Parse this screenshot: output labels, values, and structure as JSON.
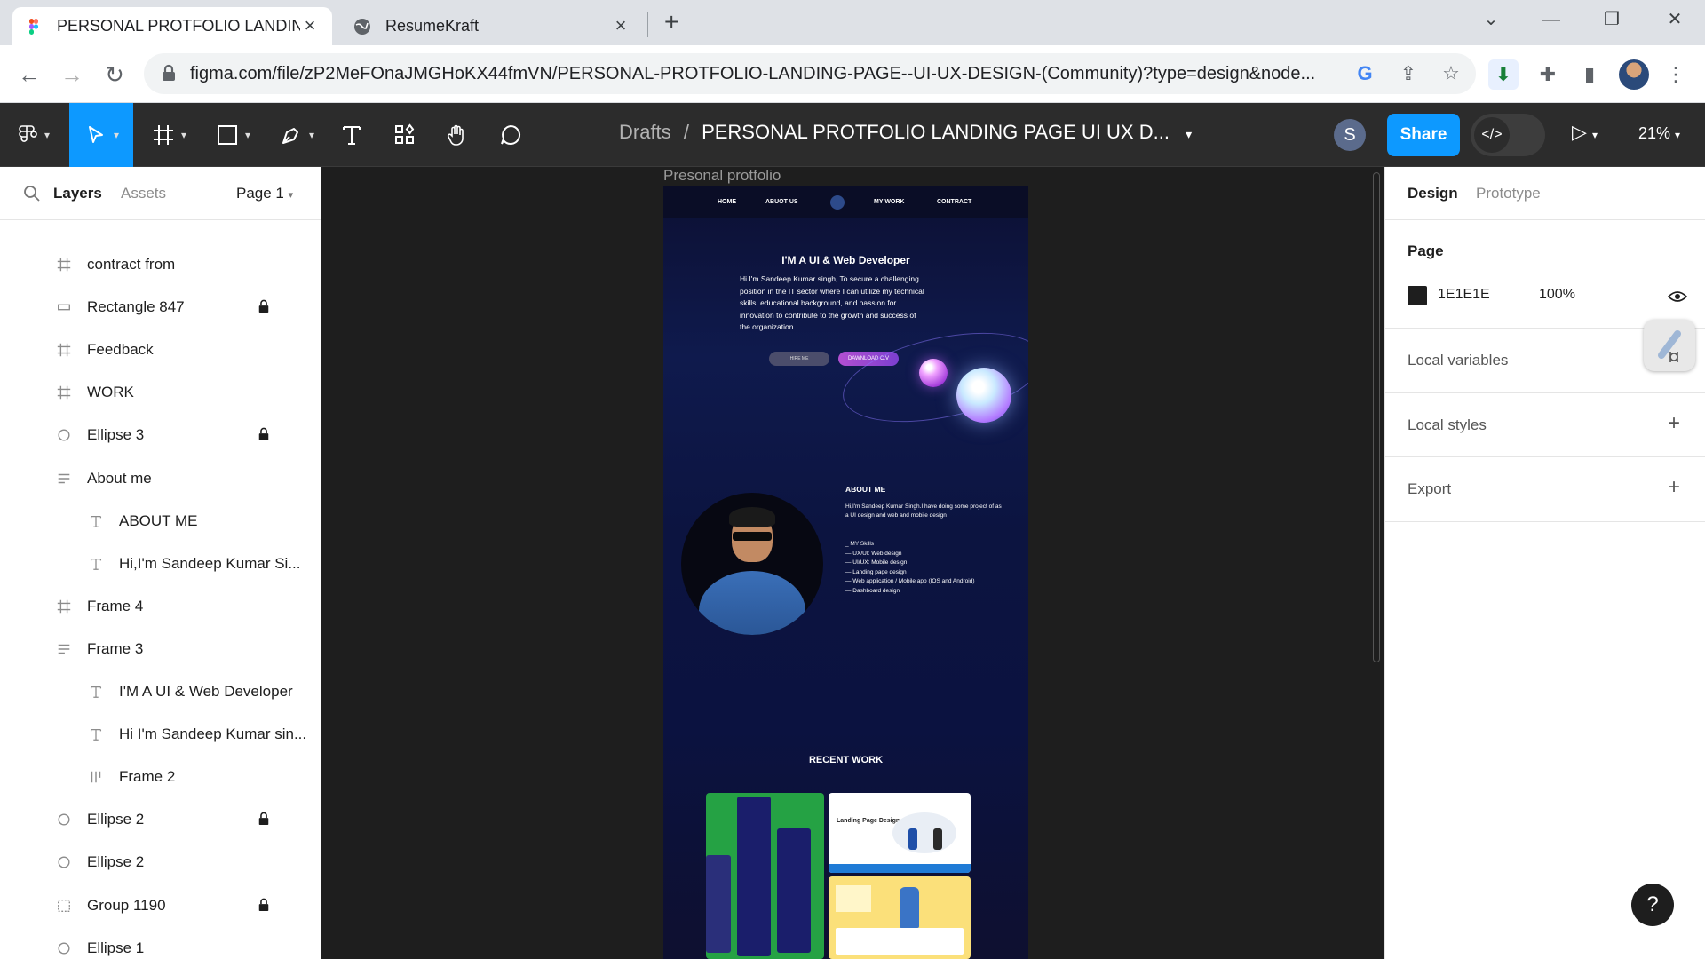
{
  "browser": {
    "tabs": [
      {
        "title": "PERSONAL PROTFOLIO LANDING",
        "active": true,
        "icon": "figma-icon"
      },
      {
        "title": "ResumeKraft",
        "active": false,
        "icon": "globe-icon"
      }
    ],
    "url": "figma.com/file/zP2MeFOnaJMGHoKX44fmVN/PERSONAL-PROTFOLIO-LANDING-PAGE--UI-UX-DESIGN-(Community)?type=design&node..."
  },
  "figma_toolbar": {
    "breadcrumb_root": "Drafts",
    "breadcrumb_sep": "/",
    "file_title": "PERSONAL PROTFOLIO LANDING PAGE UI UX D...",
    "user_initial": "S",
    "share_label": "Share",
    "zoom": "21%"
  },
  "left_panel": {
    "tab_layers": "Layers",
    "tab_assets": "Assets",
    "page_select": "Page 1",
    "layers": [
      {
        "name": "contract from",
        "icon": "frame-icon",
        "indent": 0,
        "locked": false
      },
      {
        "name": "Rectangle 847",
        "icon": "rectangle-icon",
        "indent": 0,
        "locked": true
      },
      {
        "name": "Feedback",
        "icon": "frame-icon",
        "indent": 0,
        "locked": false
      },
      {
        "name": "WORK",
        "icon": "frame-icon",
        "indent": 0,
        "locked": false
      },
      {
        "name": "Ellipse 3",
        "icon": "ellipse-icon",
        "indent": 0,
        "locked": true
      },
      {
        "name": "About me",
        "icon": "autolayout-vertical-icon",
        "indent": 0,
        "locked": false
      },
      {
        "name": "ABOUT ME",
        "icon": "text-icon",
        "indent": 1,
        "locked": false
      },
      {
        "name": "Hi,I'm Sandeep Kumar Si...",
        "icon": "text-icon",
        "indent": 1,
        "locked": false
      },
      {
        "name": "Frame 4",
        "icon": "frame-icon",
        "indent": 0,
        "locked": false
      },
      {
        "name": "Frame 3",
        "icon": "autolayout-vertical-icon",
        "indent": 0,
        "locked": false
      },
      {
        "name": "I'M A UI & Web Developer",
        "icon": "text-icon",
        "indent": 1,
        "locked": false
      },
      {
        "name": "Hi I'm Sandeep Kumar sin...",
        "icon": "text-icon",
        "indent": 1,
        "locked": false
      },
      {
        "name": "Frame 2",
        "icon": "autolayout-horizontal-icon",
        "indent": 1,
        "locked": false
      },
      {
        "name": "Ellipse 2",
        "icon": "ellipse-icon",
        "indent": 0,
        "locked": true
      },
      {
        "name": "Ellipse 2",
        "icon": "ellipse-icon",
        "indent": 0,
        "locked": false
      },
      {
        "name": "Group 1190",
        "icon": "group-icon",
        "indent": 0,
        "locked": true
      },
      {
        "name": "Ellipse 1",
        "icon": "ellipse-icon",
        "indent": 0,
        "locked": false
      }
    ]
  },
  "canvas": {
    "frame_label": "Presonal protfolio",
    "nav": [
      "HOME",
      "ABUOT US",
      "MY WORK",
      "CONTRACT"
    ],
    "hero_title": "I'M A  UI & Web Developer",
    "hero_text": "Hi  I'm Sandeep Kumar singh,  To secure a challenging position in the IT sector where I can utilize my technical skills, educational background, and passion for innovation to contribute to the growth and success of the organization.",
    "btn_hire": "HIRE ME",
    "btn_download": "DAWNLOAD C.V",
    "about_title": "ABOUT ME",
    "about_text": "Hi,I'm Sandeep Kumar Singh.I have doing some project of  as a UI design and  web and mobile design",
    "skills": [
      "_ MY Skills",
      "— UX/UI: Web design",
      "— UI/UX: Mobile design",
      "— Landing page design",
      "— Web application / Mobile app (IOS and Android)",
      "— Dashboard design"
    ],
    "recent_title": "RECENT WORK",
    "work_landing_label": "Landing Page Design"
  },
  "right_panel": {
    "tab_design": "Design",
    "tab_prototype": "Prototype",
    "page_heading": "Page",
    "page_color": "1E1E1E",
    "page_opacity": "100%",
    "local_variables": "Local variables",
    "local_styles": "Local styles",
    "export": "Export"
  },
  "help_label": "?",
  "colors": {
    "figma_blue": "#0d99ff",
    "canvas_bg": "#1e1e1e",
    "toolbar_bg": "#2c2c2c"
  }
}
